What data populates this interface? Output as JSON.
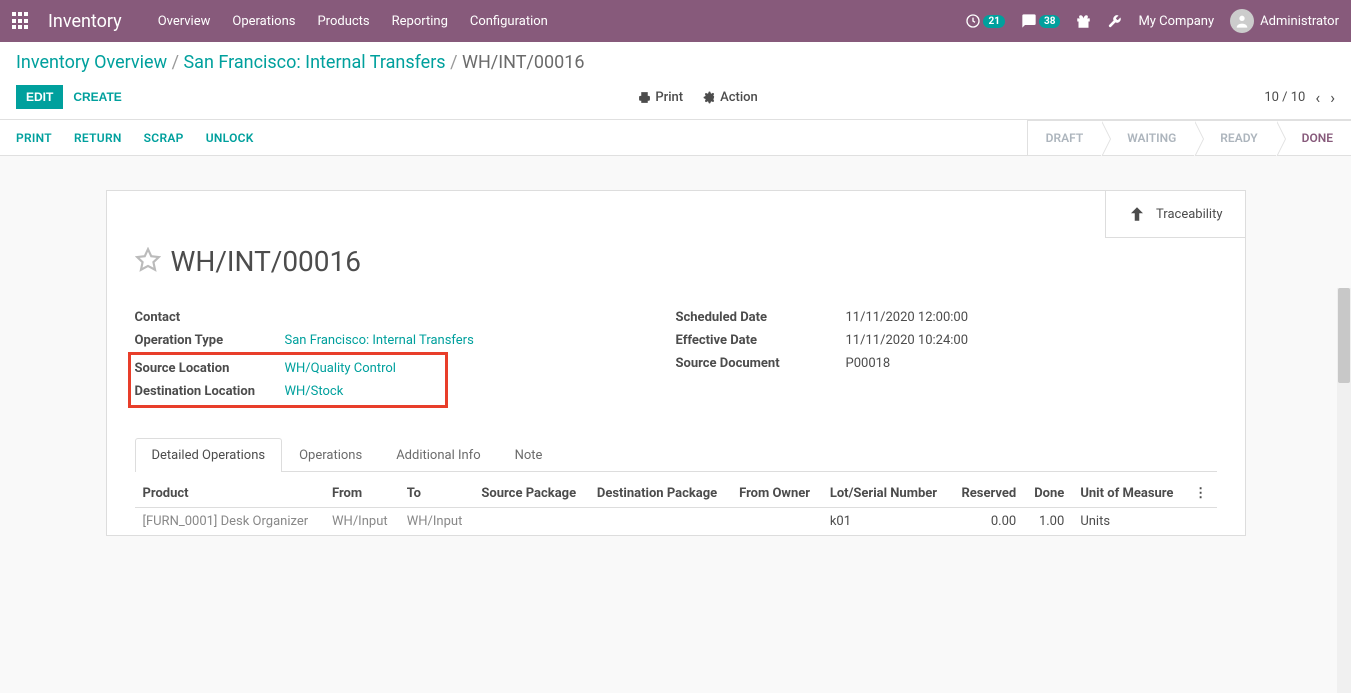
{
  "topbar": {
    "brand": "Inventory",
    "nav": [
      "Overview",
      "Operations",
      "Products",
      "Reporting",
      "Configuration"
    ],
    "clock_badge": "21",
    "chat_badge": "38",
    "company": "My Company",
    "user": "Administrator"
  },
  "breadcrumb": {
    "items": [
      {
        "label": "Inventory Overview",
        "link": true
      },
      {
        "label": "San Francisco: Internal Transfers",
        "link": true
      },
      {
        "label": "WH/INT/00016",
        "link": false
      }
    ]
  },
  "buttons": {
    "edit": "EDIT",
    "create": "CREATE",
    "print": "Print",
    "action": "Action"
  },
  "pager": {
    "text": "10 / 10"
  },
  "toolbar": [
    "PRINT",
    "RETURN",
    "SCRAP",
    "UNLOCK"
  ],
  "statusbar": [
    "DRAFT",
    "WAITING",
    "READY",
    "DONE"
  ],
  "statusbar_active": "DONE",
  "button_box": {
    "label": "Traceability"
  },
  "record": {
    "title": "WH/INT/00016",
    "fields_left": {
      "contact_label": "Contact",
      "contact_val": "",
      "op_type_label": "Operation Type",
      "op_type_val": "San Francisco: Internal Transfers",
      "src_loc_label": "Source Location",
      "src_loc_val": "WH/Quality Control",
      "dst_loc_label": "Destination Location",
      "dst_loc_val": "WH/Stock"
    },
    "fields_right": {
      "sched_label": "Scheduled Date",
      "sched_val": "11/11/2020 12:00:00",
      "eff_label": "Effective Date",
      "eff_val": "11/11/2020 10:24:00",
      "srcdoc_label": "Source Document",
      "srcdoc_val": "P00018"
    }
  },
  "tabs": [
    "Detailed Operations",
    "Operations",
    "Additional Info",
    "Note"
  ],
  "tabs_active": "Detailed Operations",
  "grid": {
    "headers": [
      "Product",
      "From",
      "To",
      "Source Package",
      "Destination Package",
      "From Owner",
      "Lot/Serial Number",
      "Reserved",
      "Done",
      "Unit of Measure"
    ],
    "rows": [
      {
        "product": "[FURN_0001] Desk Organizer",
        "from": "WH/Input",
        "to": "WH/Input",
        "src_pkg": "",
        "dst_pkg": "",
        "owner": "",
        "lot": "k01",
        "reserved": "0.00",
        "done": "1.00",
        "uom": "Units"
      }
    ]
  }
}
